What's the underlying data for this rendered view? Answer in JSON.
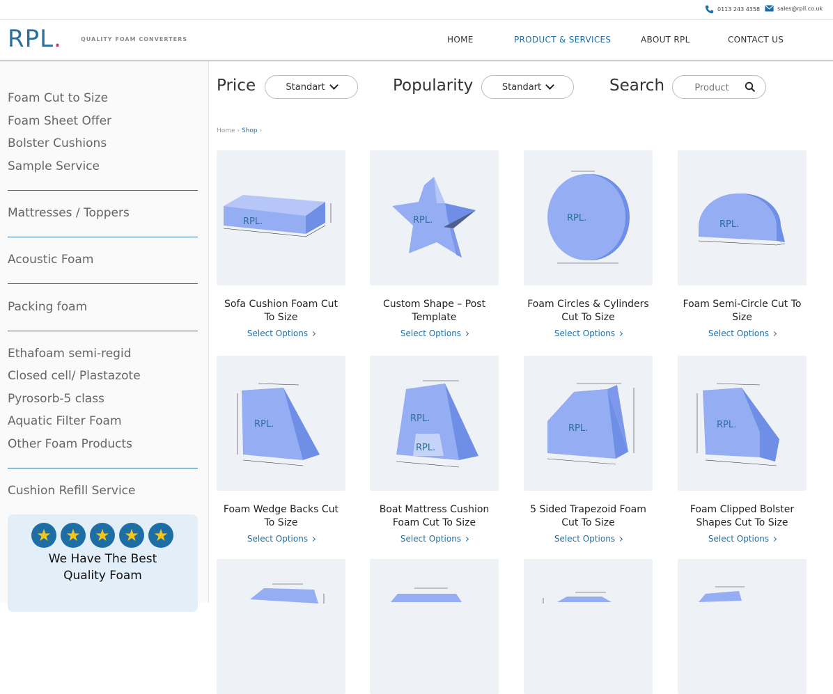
{
  "topbar": {
    "phone": "0113 243 4358",
    "email": "sales@rpll.co.uk"
  },
  "header": {
    "logo_text": "RPL",
    "logo_dot": ".",
    "tagline": "QUALITY FOAM CONVERTERS",
    "nav": [
      "HOME",
      "PRODUCT & SERVICES",
      "ABOUT RPL",
      "CONTACT US"
    ],
    "active_nav": "PRODUCT & SERVICES"
  },
  "sidebar": {
    "groups": [
      [
        "Foam Cut to Size",
        "Foam Sheet Offer",
        "Bolster Cushions",
        "Sample Service"
      ],
      [
        "Mattresses / Toppers"
      ],
      [
        "Acoustic Foam"
      ],
      [
        "Packing foam"
      ],
      [
        "Ethafoam semi-regid",
        "Closed cell/ Plastazote",
        "Pyrosorb-5 class",
        "Aquatic Filter Foam",
        "Other Foam Products"
      ],
      [
        "Cushion Refill Service"
      ]
    ],
    "review": {
      "star_count": 5,
      "text_line1": "We Have The Best",
      "text_line2": "Quality Foam"
    }
  },
  "filters": {
    "price_label": "Price",
    "price_value": "Standart",
    "popularity_label": "Popularity",
    "popularity_value": "Standart",
    "search_label": "Search",
    "search_placeholder": "Product"
  },
  "breadcrumb": {
    "home": "Home",
    "current": "Shop"
  },
  "products": [
    {
      "name_line1": "Sofa Cushion Foam Cut",
      "name_line2": "To Size",
      "cta": "Select Options"
    },
    {
      "name_line1": "Custom Shape – Post",
      "name_line2": "Template",
      "cta": "Select Options"
    },
    {
      "name_line1": "Foam Circles & Cylinders",
      "name_line2": "Cut To Size",
      "cta": "Select Options"
    },
    {
      "name_line1": "Foam Semi-Circle Cut To",
      "name_line2": "Size",
      "cta": "Select Options"
    },
    {
      "name_line1": "Foam Wedge Backs Cut",
      "name_line2": "To Size",
      "cta": "Select Options"
    },
    {
      "name_line1": "Boat Mattress Cushion",
      "name_line2": "Foam Cut To Size",
      "cta": "Select Options"
    },
    {
      "name_line1": "5 Sided Trapezoid Foam",
      "name_line2": "Cut To Size",
      "cta": "Select Options"
    },
    {
      "name_line1": "Foam Clipped Bolster",
      "name_line2": "Shapes Cut To Size",
      "cta": "Select Options"
    }
  ],
  "product_image_label": "RPL.",
  "colors": {
    "brand": "#2d6f9a",
    "accent": "#e2237a",
    "link": "#1e6ea6",
    "foam": "#8fa8f0"
  }
}
